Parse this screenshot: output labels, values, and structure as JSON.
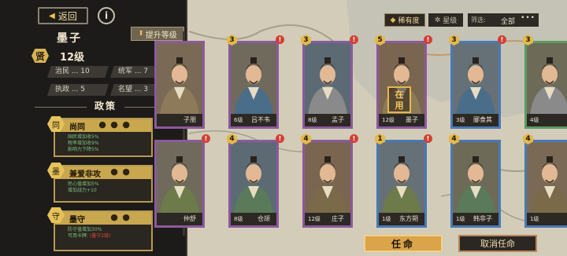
{
  "header": {
    "back_label": "返回",
    "info_label": "i",
    "hero_name": "墨子",
    "upgrade_label": "提升等级"
  },
  "hero": {
    "rank_char": "贤",
    "level": "12级",
    "stats": [
      {
        "label": "治民 ... 10"
      },
      {
        "label": "统军 ... 7"
      },
      {
        "label": "执政 ... 5"
      },
      {
        "label": "名望 ... 3"
      }
    ]
  },
  "policy_section": {
    "title": "政策",
    "items": [
      {
        "icon": "同",
        "name": "尚同",
        "dots": "● ● ●",
        "desc": [
          "国民增加收5%",
          "税率增加收9%",
          "影响力下降5%"
        ],
        "desc_color": "green"
      },
      {
        "icon": "墨",
        "name": "兼爱非攻",
        "dots": "● ●",
        "desc": [
          "民心值增加5%",
          "增加战力+10"
        ],
        "desc_color": "green"
      },
      {
        "icon": "守",
        "name": "墨守",
        "dots": "● ●",
        "desc": [
          "防守值增加30%",
          "可用卡牌:",
          "(墨守2级)"
        ],
        "desc_color": "red"
      }
    ]
  },
  "filters": {
    "sort_label": "稀有度",
    "star_label": "星级",
    "filter_label": "筛选:",
    "filter_value": "全部",
    "more_label": "•••"
  },
  "cards_row1": [
    {
      "level": "",
      "name": "子朋",
      "badge": "",
      "alert": false,
      "color": "purple"
    },
    {
      "level": "6级",
      "name": "吕不韦",
      "badge": "3",
      "alert": true,
      "color": "purple"
    },
    {
      "level": "8级",
      "name": "孟子",
      "badge": "3",
      "alert": true,
      "color": "purple"
    },
    {
      "level": "12级",
      "name": "墨子",
      "badge": "5",
      "alert": true,
      "color": "purple"
    },
    {
      "level": "3级",
      "name": "郦食其",
      "badge": "3",
      "alert": true,
      "color": "blue"
    },
    {
      "level": "4级",
      "name": "",
      "badge": "3",
      "alert": true,
      "color": "green"
    }
  ],
  "cards_row2": [
    {
      "level": "",
      "name": "仲舒",
      "badge": "",
      "alert": true,
      "color": "purple"
    },
    {
      "level": "8级",
      "name": "仓颉",
      "badge": "4",
      "alert": true,
      "color": "purple"
    },
    {
      "level": "12级",
      "name": "庄子",
      "badge": "4",
      "alert": true,
      "color": "purple"
    },
    {
      "level": "1级",
      "name": "东方朔",
      "badge": "1",
      "alert": true,
      "color": "blue"
    },
    {
      "level": "1级",
      "name": "韩非子",
      "badge": "4",
      "alert": false,
      "color": "blue"
    },
    {
      "level": "1级",
      "name": "",
      "badge": "4",
      "alert": false,
      "color": "blue"
    }
  ],
  "hired_stamp": "在\n用",
  "buttons": {
    "appoint_label": "任命",
    "cancel_label": "取消任命"
  },
  "colors": {
    "purple_border": "#8b5a9c",
    "blue_border": "#4a79b4",
    "green_border": "#5a9b64",
    "gold_accent": "#d9a44a"
  }
}
